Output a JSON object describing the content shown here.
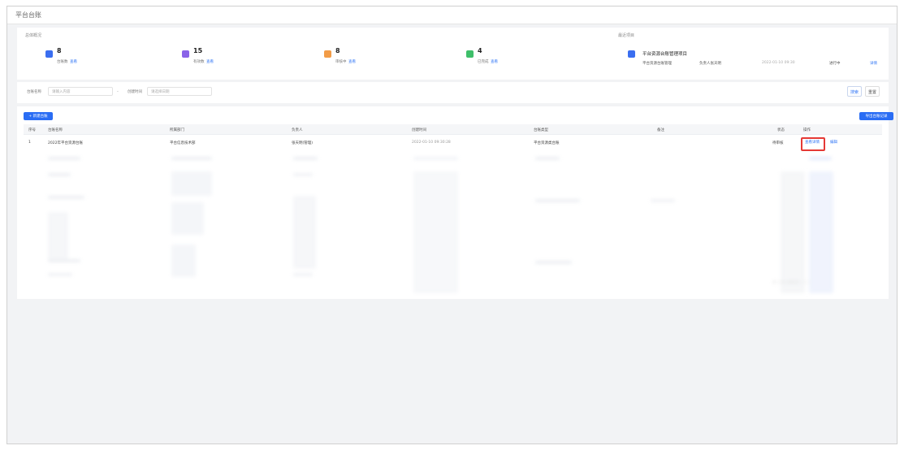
{
  "header": {
    "breadcrumb": "平台台账"
  },
  "stats": {
    "section_label": "总体概况",
    "cards": [
      {
        "value": "8",
        "label": "台账数",
        "link": "查看",
        "color": "#3a6ef0"
      },
      {
        "value": "15",
        "label": "有效数",
        "link": "查看",
        "color": "#8a63e8"
      },
      {
        "value": "8",
        "label": "审核中",
        "link": "查看",
        "color": "#f29c47"
      },
      {
        "value": "4",
        "label": "已完成",
        "link": "查看",
        "color": "#3fbf6a"
      }
    ],
    "project": {
      "section_label": "最近项目",
      "title": "平台资源台账管理项目",
      "meta": [
        "平台资源台账管理",
        "负责人张天明",
        "2022-01-10 09:30",
        "进行中"
      ],
      "link": "详情",
      "icon_color": "#3a6ef0"
    }
  },
  "filters": {
    "label1": "台账名称",
    "value1": "请输入内容",
    "label2": "创建时间",
    "value2": "请选择日期",
    "search_label": "搜索",
    "reset_label": "重置"
  },
  "toolbar": {
    "add_label": "+ 新建台账",
    "export_label": "导出台账记录"
  },
  "table": {
    "columns": [
      "序号",
      "台账名称",
      "所属部门",
      "负责人",
      "创建时间",
      "台账类型",
      "备注",
      "状态",
      "操作"
    ],
    "rows": [
      {
        "index": "1",
        "name": "2022年平台资源台账",
        "dept": "平台信息技术部",
        "owner": "张天明(管理)",
        "time": "2022-01-10 09:30:28",
        "type": "平台资源类台账",
        "remark": "",
        "status": "待审核",
        "op_primary": "查看详情",
        "op_secondary": "编辑"
      }
    ]
  },
  "pagination": {
    "text": "共 1 条  10条/页  < 1 >"
  }
}
